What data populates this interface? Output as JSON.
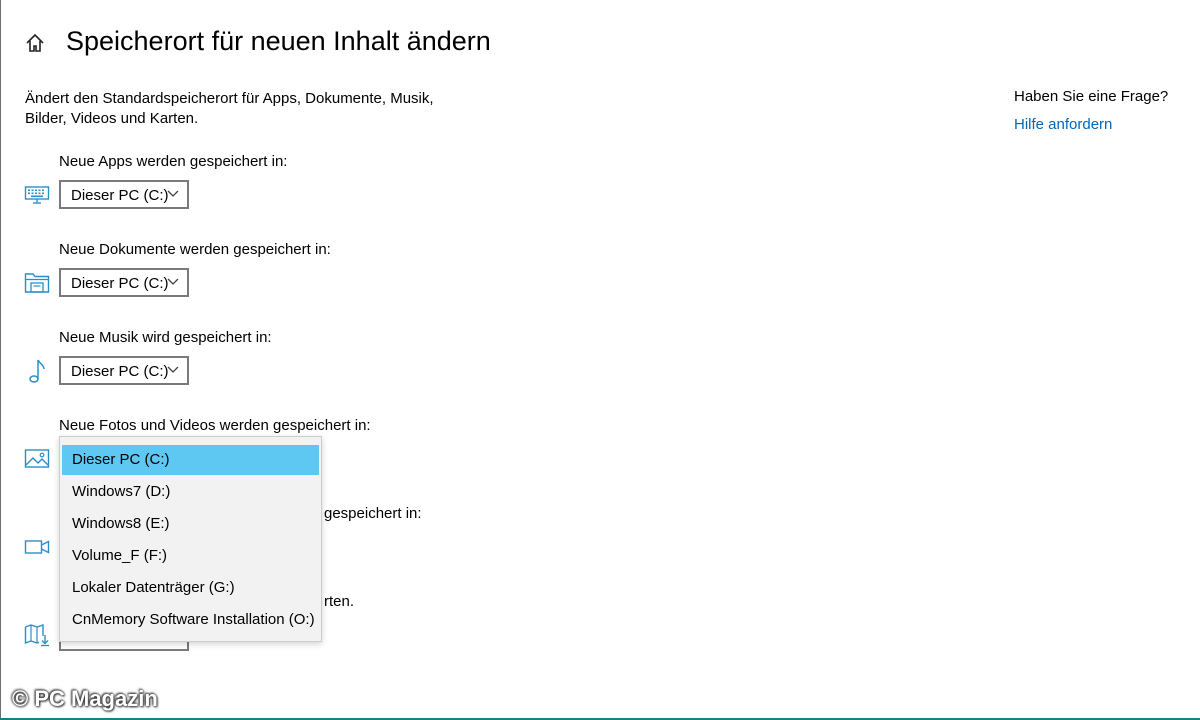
{
  "page": {
    "title": "Speicherort für neuen Inhalt ändern",
    "description": "Ändert den Standardspeicherort für Apps, Dokumente, Musik, Bilder, Videos und Karten."
  },
  "help": {
    "question": "Haben Sie eine Frage?",
    "link": "Hilfe anfordern"
  },
  "settings": [
    {
      "label": "Neue Apps werden gespeichert in:",
      "icon": "keyboard-icon",
      "value": "Dieser PC (C:)"
    },
    {
      "label": "Neue Dokumente werden gespeichert in:",
      "icon": "documents-folder-icon",
      "value": "Dieser PC (C:)"
    },
    {
      "label": "Neue Musik wird gespeichert in:",
      "icon": "music-note-icon",
      "value": "Dieser PC (C:)"
    },
    {
      "label": "Neue Fotos und Videos werden gespeichert in:",
      "icon": "picture-icon",
      "value": "Dieser PC (C:)"
    },
    {
      "label_visible_fragment": "gespeichert in:",
      "icon": "video-camera-icon"
    },
    {
      "label_visible_fragment": "rten.",
      "icon": "offline-maps-icon"
    }
  ],
  "dropdown_open": {
    "options": [
      "Dieser PC (C:)",
      "Windows7 (D:)",
      "Windows8 (E:)",
      "Volume_F (F:)",
      "Lokaler Datenträger (G:)",
      "CnMemory Software Installation (O:)"
    ],
    "selected": "Dieser PC (C:)"
  },
  "watermark": "© PC Magazin",
  "colors": {
    "accent": "#0067b8",
    "icon": "#2a8fc9",
    "selected_item": "#5ec8f2",
    "popup_background": "#f2f2f2"
  }
}
